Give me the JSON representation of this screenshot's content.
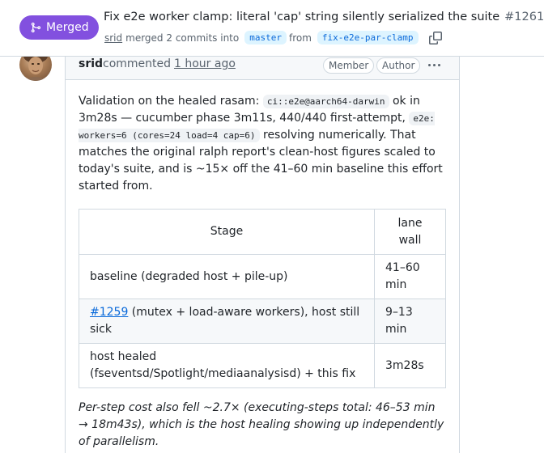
{
  "colors": {
    "merged": "#8250df",
    "link": "#0969da",
    "muted": "#59636e",
    "border": "#d1d9e0"
  },
  "header": {
    "state": "Merged",
    "state_icon": "git-merge-icon",
    "title": "Fix e2e worker clamp: literal 'cap' string silently serialized the suite",
    "number": "#1261",
    "meta": {
      "author": "srid",
      "merged_text": "merged 2 commits into",
      "base_branch": "master",
      "from_text": "from",
      "head_branch": "fix-e2e-par-clamp",
      "copy_icon": "copy-icon"
    }
  },
  "comment": {
    "author": "srid",
    "action": "commented",
    "time": "1 hour ago",
    "badges": [
      "Member",
      "Author"
    ],
    "menu_icon": "kebab-horizontal-icon",
    "paragraph1": {
      "t1": "Validation on the healed rasam: ",
      "code1": "ci::e2e@aarch64-darwin",
      "t2": " ok in 3m28s — cucumber phase 3m11s, 440/440 first-attempt, ",
      "code2": "e2e: workers=6 (cores=24 load=4 cap=6)",
      "t3": " resolving numerically. That matches the original ralph report's clean-host figures scaled to today's suite, and is ~15× off the 41–60 min baseline this effort started from."
    },
    "table": {
      "headers": [
        "Stage",
        "lane wall"
      ],
      "rows": [
        {
          "stage": "baseline (degraded host + pile-up)",
          "wall": "41–60 min"
        },
        {
          "link": "#1259",
          "stage": " (mutex + load-aware workers), host still sick",
          "wall": "9–13 min"
        },
        {
          "stage": "host healed (fseventsd/Spotlight/mediaanalysisd) + this fix",
          "wall": "3m28s"
        }
      ]
    },
    "footnote": "Per-step cost also fell ~2.7× (executing-steps total: 46–53 min → 18m43s), which is the host healing showing up independently of parallelism."
  }
}
